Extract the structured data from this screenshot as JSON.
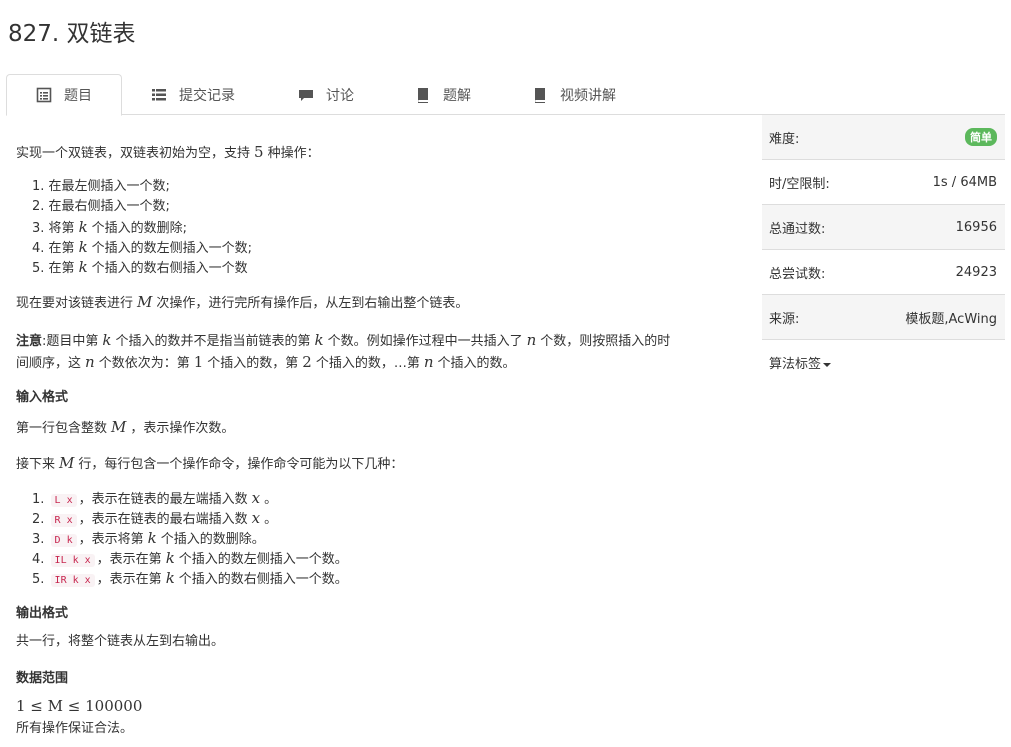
{
  "page": {
    "title": "827. 双链表"
  },
  "tabs": [
    {
      "label": "题目",
      "icon": "list-alt-icon"
    },
    {
      "label": "提交记录",
      "icon": "list-icon"
    },
    {
      "label": "讨论",
      "icon": "comment-icon"
    },
    {
      "label": "题解",
      "icon": "book-icon"
    },
    {
      "label": "视频讲解",
      "icon": "book-icon"
    }
  ],
  "problem": {
    "intro": "实现一个双链表，双链表初始为空，支持 5 种操作：",
    "intro_a": "实现一个双链表，双链表初始为空，支持",
    "intro_n": "5",
    "intro_b": "种操作：",
    "ops": [
      {
        "a": "在最左侧插入一个数;",
        "k": "",
        "b": ""
      },
      {
        "a": "在最右侧插入一个数;",
        "k": "",
        "b": ""
      },
      {
        "a": "将第",
        "k": "k",
        "b": "个插入的数删除;"
      },
      {
        "a": "在第",
        "k": "k",
        "b": "个插入的数左侧插入一个数;"
      },
      {
        "a": "在第",
        "k": "k",
        "b": "个插入的数右侧插入一个数"
      }
    ],
    "task_a": "现在要对该链表进行",
    "task_m": "M",
    "task_b": "次操作，进行完所有操作后，从左到右输出整个链表。",
    "note_label": "注意",
    "note_1a": ":题目中第",
    "note_1k": "k",
    "note_1b": "个插入的数并不是指当前链表的第",
    "note_1k2": "k",
    "note_1c": "个数。例如操作过程中一共插入了",
    "note_1n": "n",
    "note_1d": "个数，则按照插入的时",
    "note_2a": "间顺序，这",
    "note_2n": "n",
    "note_2b": "个数依次为：第",
    "note_2one": "1",
    "note_2c": "个插入的数，第",
    "note_2two": "2",
    "note_2d": "个插入的数，…第",
    "note_2n2": "n",
    "note_2e": "个插入的数。",
    "input_title": "输入格式",
    "input_1a": "第一行包含整数",
    "input_1m": "M",
    "input_1b": "，表示操作次数。",
    "input_2a": "接下来",
    "input_2m": "M",
    "input_2b": "行，每行包含一个操作命令，操作命令可能为以下几种：",
    "cmds": [
      {
        "code": "L x",
        "a": "，表示在链表的最左端插入数",
        "v": "x",
        "b": "。"
      },
      {
        "code": "R x",
        "a": "，表示在链表的最右端插入数",
        "v": "x",
        "b": "。"
      },
      {
        "code": "D k",
        "a": "，表示将第",
        "v": "k",
        "b": "个插入的数删除。"
      },
      {
        "code": "IL k x",
        "a": "，表示在第",
        "v": "k",
        "b": "个插入的数左侧插入一个数。"
      },
      {
        "code": "IR k x",
        "a": "，表示在第",
        "v": "k",
        "b": "个插入的数右侧插入一个数。"
      }
    ],
    "output_title": "输出格式",
    "output_text": "共一行，将整个链表从左到右输出。",
    "range_title": "数据范围",
    "range_expr": "1 ≤ M ≤ 100000",
    "range_note": "所有操作保证合法。"
  },
  "sidebar": {
    "difficulty_label": "难度:",
    "difficulty_value": "简单",
    "difficulty_color": "#5cb85c",
    "limit_label": "时/空限制:",
    "limit_value": "1s / 64MB",
    "passed_label": "总通过数:",
    "passed_value": "16956",
    "tried_label": "总尝试数:",
    "tried_value": "24923",
    "source_label": "来源:",
    "source_value": "模板题,AcWing",
    "tags_label": "算法标签"
  }
}
